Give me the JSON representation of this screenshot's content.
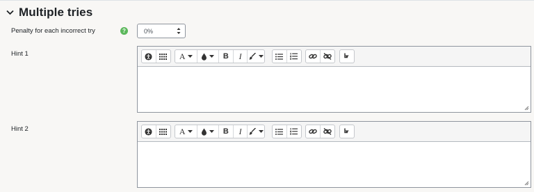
{
  "section": {
    "title": "Multiple tries",
    "icon": "chevron-down-icon"
  },
  "penalty": {
    "label": "Penalty for each incorrect try",
    "help_icon": "question-mark",
    "help_color": "#5cb85c",
    "value": "0%"
  },
  "hints": [
    {
      "label": "Hint 1"
    },
    {
      "label": "Hint 2"
    }
  ],
  "toolbar_icons": [
    "accessibility-icon",
    "equation-grid-icon",
    "font-color-icon",
    "background-color-icon",
    "bold-icon",
    "italic-icon",
    "paint-brush-icon",
    "unordered-list-icon",
    "ordered-list-icon",
    "link-icon",
    "unlink-icon",
    "line-break-icon"
  ],
  "toolbar_glyphs": {
    "font_color": "A",
    "bold": "B",
    "italic": "I"
  }
}
